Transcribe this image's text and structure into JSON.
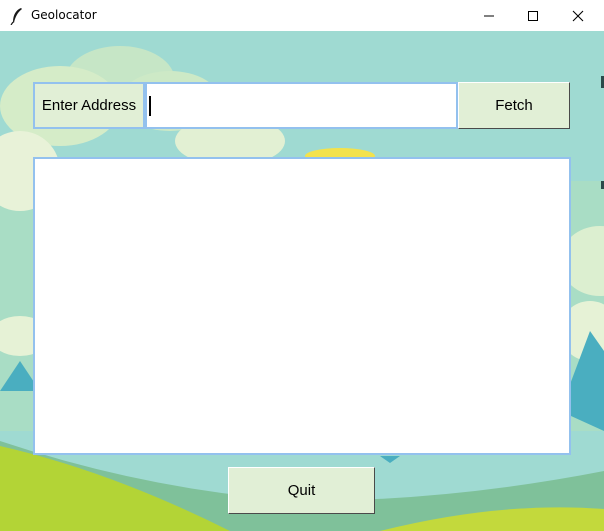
{
  "window": {
    "title": "Geolocator",
    "icon": "feather-icon",
    "controls": [
      "minimize-icon",
      "maximize-icon",
      "close-icon"
    ]
  },
  "form": {
    "address_label": "Enter Address",
    "address_value": "",
    "fetch_label": "Fetch"
  },
  "output": {
    "text": ""
  },
  "footer": {
    "quit_label": "Quit"
  },
  "colors": {
    "button_bg": "#e1efd6",
    "border": "#93c1ee",
    "sky": "#9fdad2",
    "grass": "#b2d435"
  }
}
